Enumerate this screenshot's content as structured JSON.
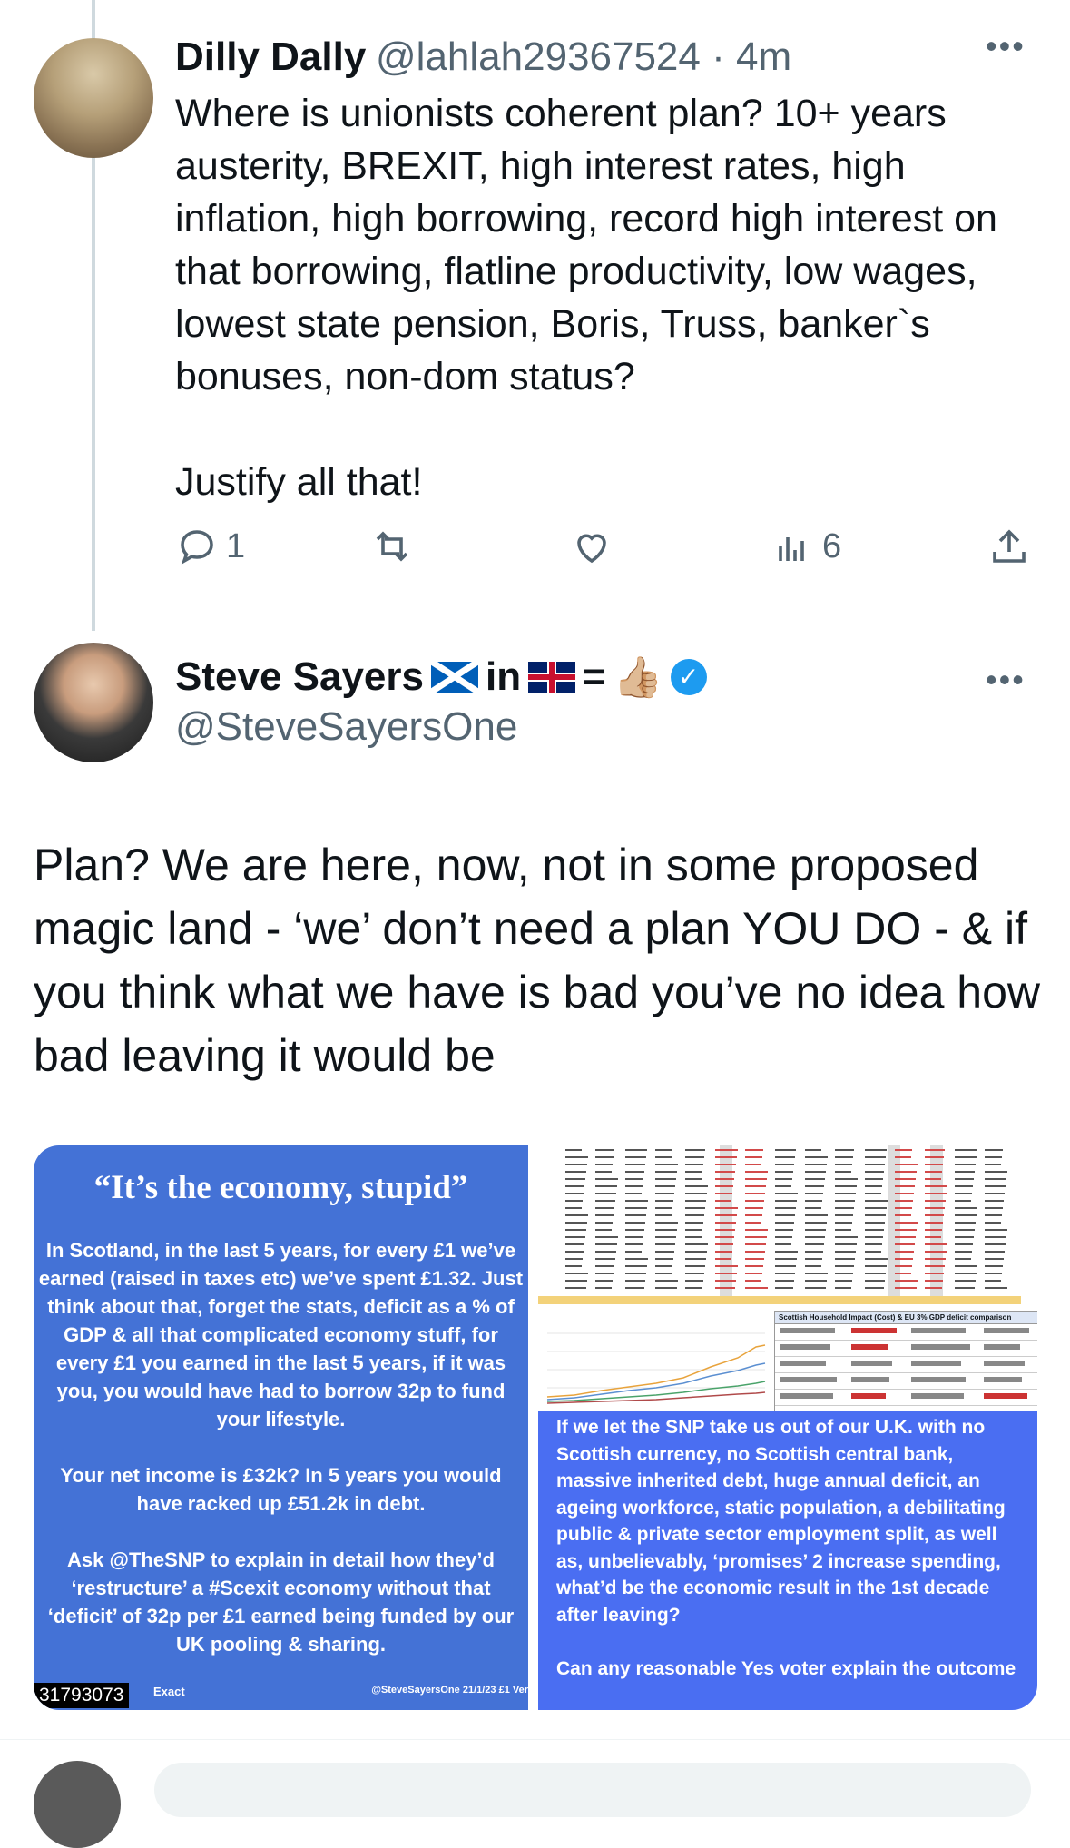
{
  "tweet1": {
    "name": "Dilly Dally",
    "handle": "@lahlah29367524 · 4m",
    "more": "•••",
    "text": "Where is unionists coherent plan? 10+ years austerity, BREXIT, high interest rates, high inflation, high borrowing, record high interest on that borrowing, flatline productivity, low wages, lowest state pension, Boris, Truss, banker`s bonuses, non-dom status?\n\nJustify all that!",
    "actions": {
      "reply_count": "1",
      "retweet_count": "",
      "like_count": "",
      "views_count": "6"
    }
  },
  "tweet2": {
    "name": "Steve Sayers",
    "name_suffix_in": "in",
    "name_suffix_eq": "=",
    "thumb": "👍🏼",
    "verified_mark": "✓",
    "handle": "@SteveSayersOne",
    "more": "•••",
    "text": "Plan? We are here, now, not in some proposed magic land - ‘we’ don’t need a plan YOU DO - & if you think what we have is bad you’ve no idea how bad leaving it would be",
    "media": {
      "left": {
        "title": "“It’s the economy, stupid”",
        "body": "In Scotland, in the last 5 years, for every £1 we’ve earned (raised in taxes etc) we’ve spent £1.32. Just think about that, forget the stats, deficit as a % of GDP & all that complicated economy stuff, for every £1 you earned in the last 5 years, if it was you, you would have had to borrow 32p to fund your lifestyle.\n\nYour net income is £32k? In 5 years you would have racked up £51.2k in debt.\n\nAsk @TheSNP to explain in detail how they’d ‘restructure’ a #Scexit economy without that ‘deficit’ of 32p per £1 earned being funded by our UK pooling & sharing.",
        "footer_id": "31793073",
        "footer_mid": "Exact",
        "footer_right": "@SteveSayersOne 21/1/23 £1 Ver"
      },
      "right": {
        "table_title": "Scottish Household Impact (Cost) & EU 3% GDP deficit comparison",
        "body": "If we let the SNP take us out of our U.K. with no Scottish currency, no Scottish central bank, massive inherited debt, huge annual deficit, an ageing workforce, static population, a debilitating public & private sector employment split, as well as, unbelievably, ‘promises’ 2 increase spending, what’d be the economic result in the 1st decade after leaving?",
        "body2": "Can any reasonable Yes voter explain the outcome"
      }
    }
  },
  "colors": {
    "text": "#0f1419",
    "secondary": "#536471",
    "verified": "#1d9bf0",
    "panel_left": "#4472d6",
    "panel_right": "#4a6ef2"
  }
}
